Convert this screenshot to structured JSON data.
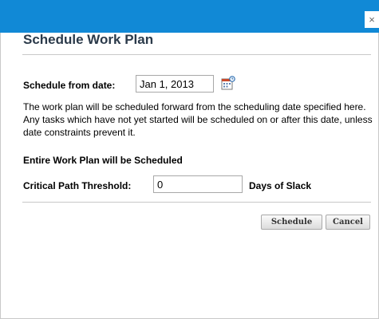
{
  "dialog": {
    "close_glyph": "×",
    "title": "Schedule Work Plan"
  },
  "schedule": {
    "date_label": "Schedule from date:",
    "date_value": "Jan 1, 2013",
    "calendar_icon": "calendar-icon"
  },
  "description": "The work plan will be scheduled forward from the scheduling date specified here. Any tasks which have not yet started will be scheduled on or after this date, unless date constraints prevent it.",
  "scope_label": "Entire Work Plan will be Scheduled",
  "threshold": {
    "label": "Critical Path Threshold:",
    "value": "0",
    "unit": "Days of Slack"
  },
  "buttons": {
    "schedule": "Schedule",
    "cancel": "Cancel"
  },
  "colors": {
    "titlebar": "#1189d6",
    "title_text": "#2b3a4a"
  }
}
